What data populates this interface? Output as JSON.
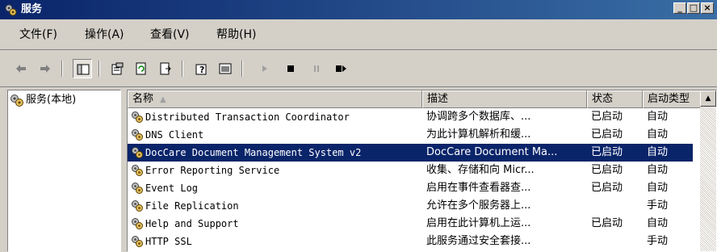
{
  "window": {
    "title": "服务"
  },
  "menu": [
    "文件(F)",
    "操作(A)",
    "查看(V)",
    "帮助(H)"
  ],
  "tree": {
    "root_label": "服务(本地)"
  },
  "columns": {
    "name": "名称",
    "description": "描述",
    "status": "状态",
    "startup": "启动类型"
  },
  "services": [
    {
      "name": "Distributed Transaction Coordinator",
      "description": "协调跨多个数据库、...",
      "status": "已启动",
      "startup": "自动"
    },
    {
      "name": "DNS Client",
      "description": "为此计算机解析和缓...",
      "status": "已启动",
      "startup": "自动"
    },
    {
      "name": "DocCare Document Management System v2",
      "description": "DocCare Document Ma...",
      "status": "已启动",
      "startup": "自动",
      "selected": true
    },
    {
      "name": "Error Reporting Service",
      "description": "收集、存储和向 Micr...",
      "status": "已启动",
      "startup": "自动"
    },
    {
      "name": "Event Log",
      "description": "启用在事件查看器查...",
      "status": "已启动",
      "startup": "自动"
    },
    {
      "name": "File Replication",
      "description": "允许在多个服务器上...",
      "status": "",
      "startup": "手动"
    },
    {
      "name": "Help and Support",
      "description": "启用在此计算机上运...",
      "status": "已启动",
      "startup": "自动"
    },
    {
      "name": "HTTP SSL",
      "description": "此服务通过安全套接...",
      "status": "",
      "startup": "手动"
    }
  ],
  "icons": {
    "toolbar": [
      "back-icon",
      "forward-icon",
      "show-tree-icon",
      "properties-icon",
      "refresh-icon",
      "export-list-icon",
      "help-icon",
      "console-view-icon",
      "start-service-icon",
      "stop-service-icon",
      "pause-service-icon",
      "restart-service-icon"
    ]
  },
  "colors": {
    "titlebar": "#0a246a",
    "selection": "#0a246a",
    "window_bg": "#d4d0c8"
  }
}
